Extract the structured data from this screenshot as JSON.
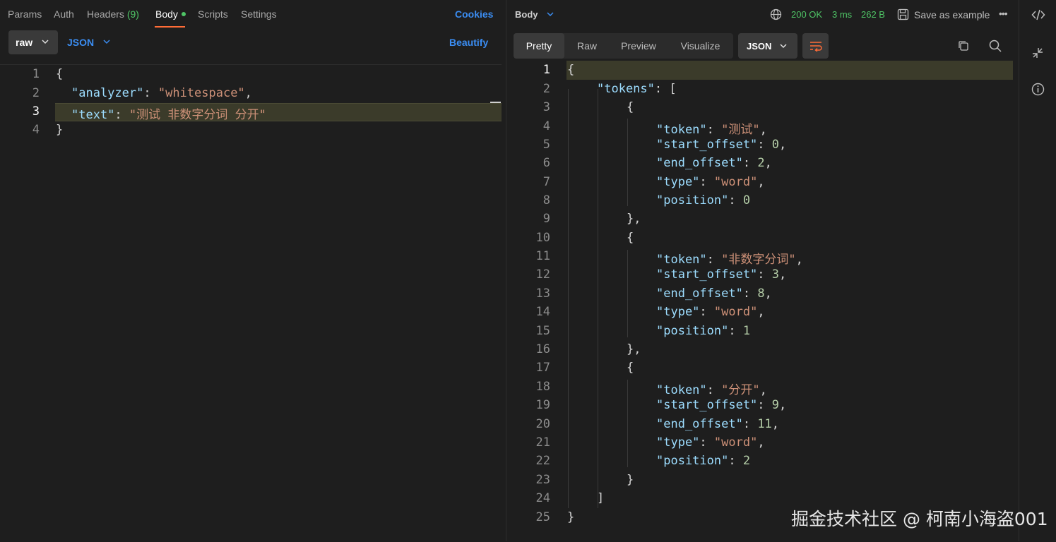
{
  "request": {
    "tabs": {
      "params": "Params",
      "auth": "Auth",
      "headers": "Headers",
      "headers_count": "(9)",
      "body": "Body",
      "scripts": "Scripts",
      "settings": "Settings"
    },
    "cookies_label": "Cookies",
    "body_mode": "raw",
    "body_format": "JSON",
    "beautify_label": "Beautify",
    "line_numbers": [
      "1",
      "2",
      "3",
      "4"
    ],
    "code": {
      "l1_open": "{",
      "l2_key": "\"analyzer\"",
      "l2_colon": ": ",
      "l2_val": "\"whitespace\"",
      "l2_comma": ",",
      "l3_key": "\"text\"",
      "l3_colon": ": ",
      "l3_val": "\"测试 非数字分词 分开\"",
      "l4_close": "}"
    }
  },
  "response": {
    "body_label": "Body",
    "status": "200 OK",
    "time": "3 ms",
    "size": "262 B",
    "save_label": "Save as example",
    "more_label": "•••",
    "view_tabs": [
      "Pretty",
      "Raw",
      "Preview",
      "Visualize"
    ],
    "format": "JSON",
    "line_numbers": [
      "1",
      "2",
      "3",
      "4",
      "5",
      "6",
      "7",
      "8",
      "9",
      "10",
      "11",
      "12",
      "13",
      "14",
      "15",
      "16",
      "17",
      "18",
      "19",
      "20",
      "21",
      "22",
      "23",
      "24",
      "25"
    ],
    "json": {
      "tokens_key": "\"tokens\"",
      "items": [
        {
          "token": "\"测试\"",
          "start_offset": "0",
          "end_offset": "2",
          "type": "\"word\"",
          "position": "0"
        },
        {
          "token": "\"非数字分词\"",
          "start_offset": "3",
          "end_offset": "8",
          "type": "\"word\"",
          "position": "1"
        },
        {
          "token": "\"分开\"",
          "start_offset": "9",
          "end_offset": "11",
          "type": "\"word\"",
          "position": "2"
        }
      ],
      "keys": {
        "token": "\"token\"",
        "start_offset": "\"start_offset\"",
        "end_offset": "\"end_offset\"",
        "type": "\"type\"",
        "position": "\"position\""
      }
    }
  },
  "watermark": "掘金技术社区 @ 柯南小海盗001",
  "colors": {
    "accent_blue": "#3b8df2",
    "status_green": "#4fc566",
    "tab_underline": "#ff6c37",
    "json_key": "#9cdcfe",
    "json_string": "#ce9178",
    "json_number": "#b5cea8"
  }
}
